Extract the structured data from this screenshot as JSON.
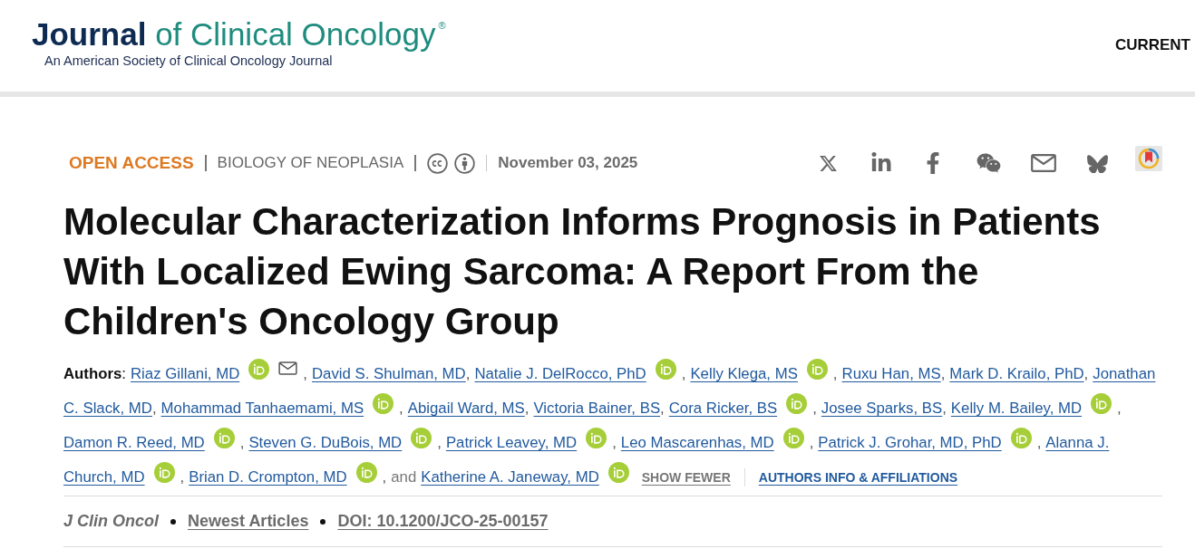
{
  "header": {
    "logo": {
      "bold": "Journal",
      "rest": "of Clinical Oncology",
      "mark": "®",
      "tagline": "An American Society of Clinical Oncology Journal"
    },
    "nav_link": "CURRENT"
  },
  "meta": {
    "access": "OPEN ACCESS",
    "section": "BIOLOGY OF NEOPLASIA",
    "date": "November 03, 2025"
  },
  "title": "Molecular Characterization Informs Prognosis in Patients With Localized Ewing Sarcoma: A Report From the Children's Oncology Group",
  "authors": {
    "label": "**Authors**:",
    "lines": [
      [
        {
          "kind": "author",
          "name": "Riaz Gillani, MD",
          "orcid": true,
          "email": true,
          "after": ","
        },
        {
          "kind": "author",
          "name": "David S. Shulman, MD",
          "orcid": false,
          "email": false,
          "after": ","
        },
        {
          "kind": "author",
          "name": "Natalie J. DelRocco, PhD",
          "orcid": true,
          "email": false,
          "after": ","
        },
        {
          "kind": "author",
          "name": "Kelly Klega, MS",
          "orcid": true,
          "email": false,
          "after": ","
        },
        {
          "kind": "author",
          "name": "Ruxu Han, MS",
          "orcid": false,
          "email": false,
          "after": ","
        },
        {
          "kind": "author",
          "name": "Mark D. Krailo, PhD",
          "orcid": false,
          "email": false,
          "after": ","
        },
        {
          "kind": "author",
          "name": "Jonathan",
          "orcid": false,
          "email": false
        }
      ],
      [
        {
          "kind": "author",
          "name": "C. Slack, MD",
          "orcid": false,
          "email": false,
          "after": ","
        },
        {
          "kind": "author",
          "name": "Mohammad Tanhaemami, MS",
          "orcid": true,
          "email": false,
          "after": ","
        },
        {
          "kind": "author",
          "name": "Abigail Ward, MS",
          "orcid": false,
          "email": false,
          "after": ","
        },
        {
          "kind": "author",
          "name": "Victoria Bainer, BS",
          "orcid": false,
          "email": false,
          "after": ","
        },
        {
          "kind": "author",
          "name": "Cora Ricker, BS",
          "orcid": true,
          "email": false,
          "after": ","
        },
        {
          "kind": "author",
          "name": "Josee Sparks, BS",
          "orcid": false,
          "email": false,
          "after": ","
        },
        {
          "kind": "author",
          "name": "Kelly M. Bailey, MD",
          "orcid": true,
          "email": false,
          "after": ","
        }
      ],
      [
        {
          "kind": "author",
          "name": "Damon R. Reed, MD",
          "orcid": true,
          "email": false,
          "after": ","
        },
        {
          "kind": "author",
          "name": "Steven G. DuBois, MD",
          "orcid": true,
          "email": false,
          "after": ","
        },
        {
          "kind": "author",
          "name": "Patrick Leavey, MD",
          "orcid": true,
          "email": false,
          "after": ","
        },
        {
          "kind": "author",
          "name": "Leo Mascarenhas, MD",
          "orcid": true,
          "email": false,
          "after": ","
        },
        {
          "kind": "author",
          "name": "Patrick J. Grohar, MD, PhD",
          "orcid": true,
          "email": false,
          "after": ","
        },
        {
          "kind": "author",
          "name": "Alanna J.",
          "orcid": false,
          "email": false
        }
      ],
      [
        {
          "kind": "author",
          "name": "Church, MD",
          "orcid": true,
          "email": false,
          "after": ","
        },
        {
          "kind": "author",
          "name": "Brian D. Crompton, MD",
          "orcid": true,
          "email": false,
          "after": ","
        },
        {
          "kind": "text",
          "text": "and"
        },
        {
          "kind": "author",
          "name": "Katherine A. Janeway, MD",
          "orcid": true,
          "email": false
        }
      ]
    ],
    "show_fewer": "SHOW FEWER",
    "info_link": "AUTHORS INFO & AFFILIATIONS"
  },
  "citation": {
    "journal": "J Clin Oncol",
    "section_link": "Newest Articles",
    "doi_link": "DOI: 10.1200/JCO-25-00157"
  }
}
